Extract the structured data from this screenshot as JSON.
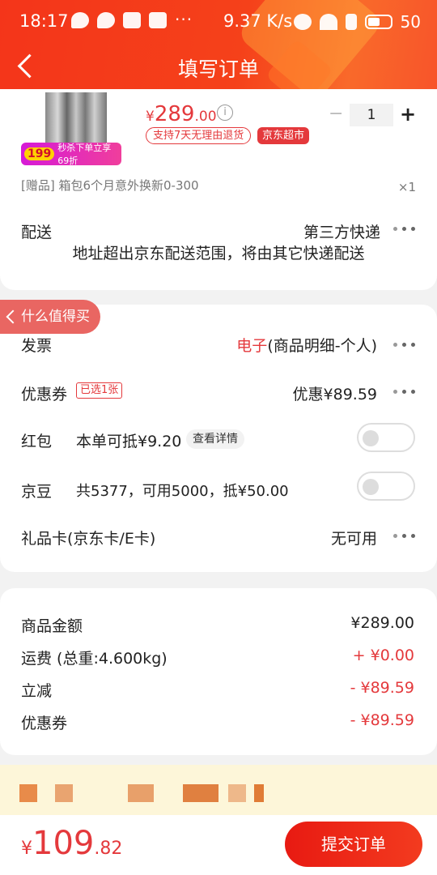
{
  "status_bar": {
    "time": "18:17",
    "speed": "9.37 K/s",
    "battery": "50"
  },
  "header": {
    "title": "填写订单"
  },
  "product": {
    "promo_num": "199",
    "promo_text": "秒杀下单立享69折",
    "price_symbol": "¥",
    "price_int": "289",
    "price_dec": ".00",
    "info": "i",
    "quantity": "1",
    "minus": "−",
    "plus": "+",
    "tag_return": "支持7天无理由退货",
    "tag_supermarket": "京东超市",
    "gift": "[赠品]  箱包6个月意外换新0-300",
    "gift_qty": "×1"
  },
  "delivery": {
    "label": "配送",
    "value": "第三方快递",
    "note": "地址超出京东配送范围，将由其它快递配送"
  },
  "float_button": "什么值得买",
  "invoice": {
    "label": "发票",
    "value_red": "电子",
    "value": "(商品明细-个人)"
  },
  "coupon": {
    "label": "优惠券",
    "badge": "已选1张",
    "value": "优惠¥89.59"
  },
  "red_packet": {
    "label": "红包",
    "text": "本单可抵¥9.20",
    "detail": "查看详情"
  },
  "jingdou": {
    "label": "京豆",
    "text": "共5377，可用5000，抵¥50.00"
  },
  "gift_card": {
    "label": "礼品卡(京东卡/E卡)",
    "value": "无可用"
  },
  "summary": [
    {
      "label": "商品金额",
      "value": "¥289.00"
    },
    {
      "label": "运费 (总重:4.600kg)",
      "value": "+ ¥0.00"
    },
    {
      "label": "立减",
      "value": "- ¥89.59"
    },
    {
      "label": "优惠券",
      "value": "- ¥89.59"
    }
  ],
  "footer": {
    "total_symbol": "¥",
    "total_int": "109",
    "total_dec": ".82",
    "submit": "提交订单"
  },
  "colors": {
    "accent": "#e4393c",
    "header": "#f4351a"
  }
}
